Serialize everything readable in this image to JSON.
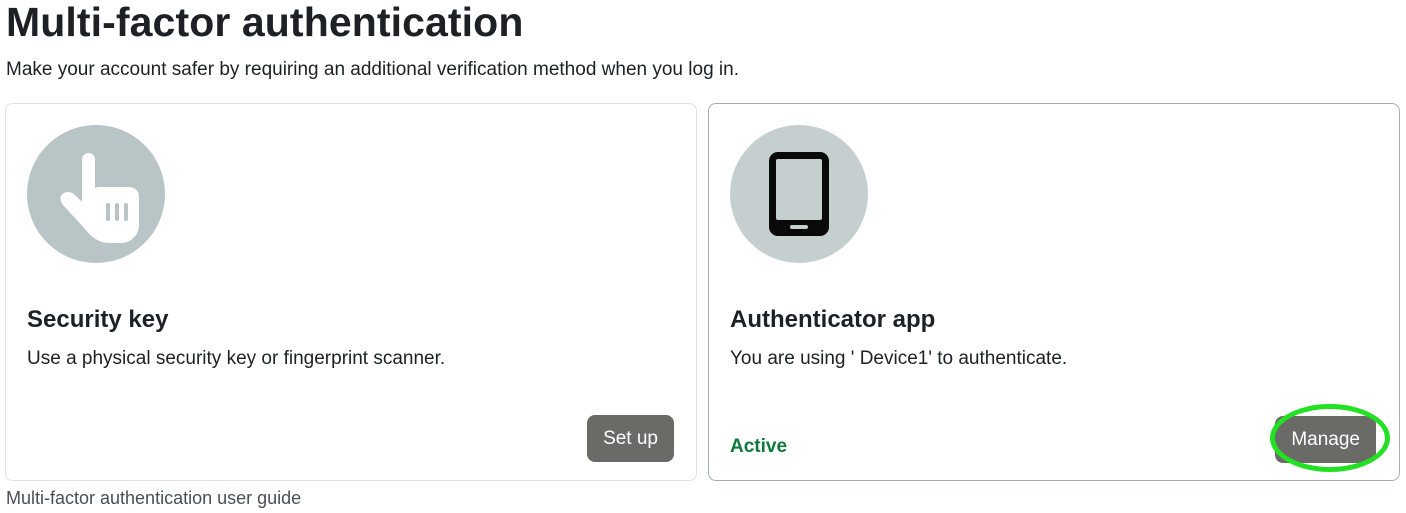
{
  "page": {
    "title": "Multi-factor authentication",
    "subtitle": "Make your account safer by requiring an additional verification method when you log in."
  },
  "methods": [
    {
      "icon": "pointer-hand-icon",
      "title": "Security key",
      "description": "Use a physical security key or fingerprint scanner.",
      "status": "",
      "button_label": "Set up"
    },
    {
      "icon": "smartphone-icon",
      "title": "Authenticator app",
      "description": "You are using ' Device1' to authenticate.",
      "status": "Active",
      "button_label": "Manage"
    }
  ],
  "footer": {
    "guide_link": "Multi-factor authentication user guide"
  },
  "colors": {
    "icon_circle": "#b8c4c6",
    "button_bg": "#6a6a66",
    "status_active": "#0f7a3d",
    "highlight": "#22e022"
  }
}
